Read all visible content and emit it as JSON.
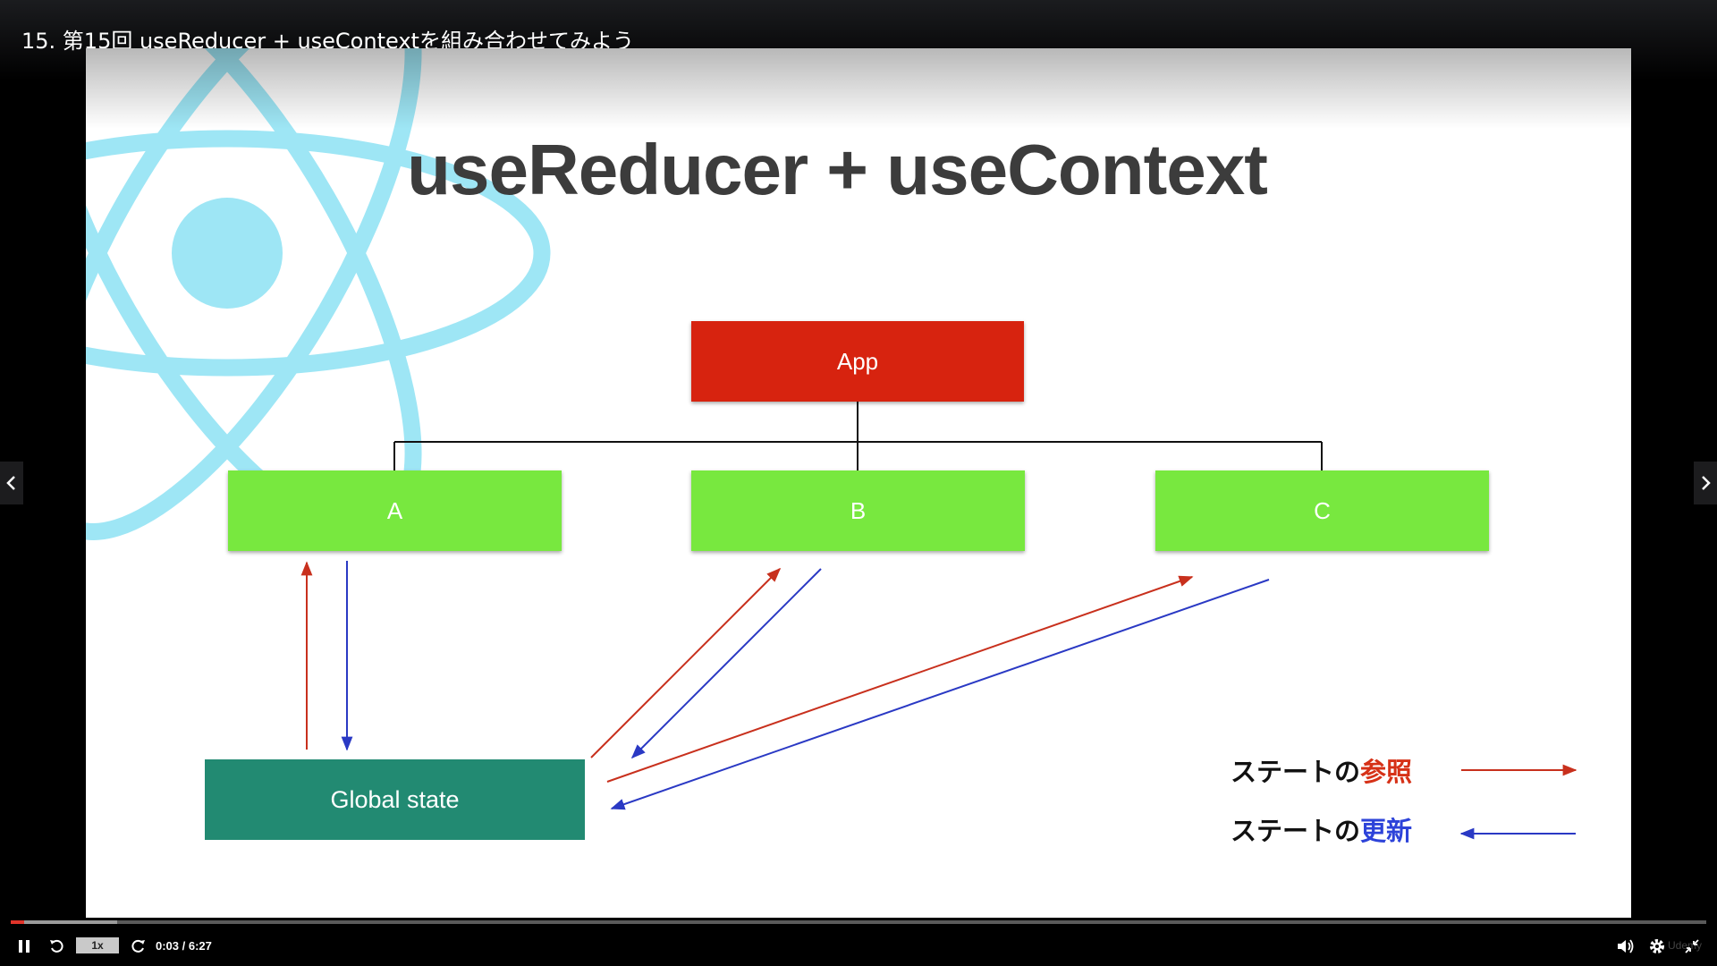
{
  "player": {
    "title": "15. 第15回 useReducer + useContextを組み合わせてみよう",
    "speed_label": "1x",
    "time": "0:03 / 6:27",
    "progress_fraction": 0.008,
    "buffer_fraction": 0.063,
    "brand": "Udemy",
    "icons": [
      "pause-icon",
      "rewind-icon",
      "forward-icon",
      "volume-icon",
      "settings-icon",
      "collapse-icon",
      "chevron-left-icon",
      "chevron-right-icon"
    ]
  },
  "slide": {
    "title": "useReducer + useContext",
    "boxes": {
      "app": "App",
      "a": "A",
      "b": "B",
      "c": "C",
      "global": "Global state"
    },
    "legend": {
      "ref_prefix": "ステートの",
      "ref_keyword": "参照",
      "update_prefix": "ステートの",
      "update_keyword": "更新"
    },
    "colors": {
      "app": "#d7230f",
      "component": "#78e83f",
      "global_state": "#228a72",
      "reference_arrow": "#c8301d",
      "update_arrow": "#2a39c4",
      "react_logo": "#9ee6f5"
    }
  }
}
